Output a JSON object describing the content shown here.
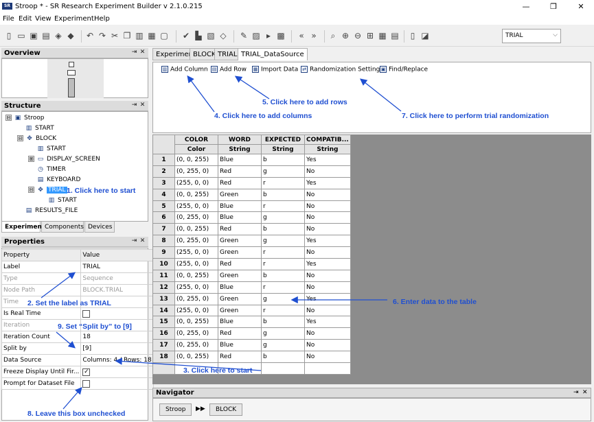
{
  "window": {
    "app_icon_text": "SR",
    "title": "Stroop * - SR Research Experiment Builder v 2.1.0.215",
    "minimize": "—",
    "maximize": "❐",
    "close": "✕"
  },
  "menu": [
    "File",
    "Edit",
    "View",
    "Experiment",
    "Help"
  ],
  "toolbar": {
    "combo_value": "TRIAL",
    "combo_arrow": "⌵",
    "icons": [
      "new-icon",
      "open-icon",
      "save-icon",
      "save-all-icon",
      "package-icon",
      "deploy-icon",
      "undo-icon",
      "redo-icon",
      "cut-icon",
      "copy-icon",
      "paste-icon",
      "delete-icon",
      "lock-icon",
      "check-icon",
      "build-icon",
      "run-icon",
      "validate-icon",
      "preferences-icon",
      "import-icon",
      "play-icon",
      "export-icon",
      "back-icon",
      "forward-icon",
      "zoom-icon",
      "zoom-in-icon",
      "zoom-out-icon",
      "fit-icon",
      "grid-icon",
      "table-icon",
      "tab-icon",
      "detach-icon"
    ]
  },
  "overview": {
    "title": "Overview"
  },
  "structure": {
    "title": "Structure",
    "tree": [
      {
        "label": "Stroop",
        "icon": "experiment-icon",
        "expander": "⊟"
      },
      {
        "label": "START",
        "icon": "start-icon"
      },
      {
        "label": "BLOCK",
        "icon": "sequence-icon",
        "expander": "⊟"
      },
      {
        "label": "START",
        "icon": "start-icon"
      },
      {
        "label": "DISPLAY_SCREEN",
        "icon": "display-screen-icon",
        "expander": "⊞"
      },
      {
        "label": "TIMER",
        "icon": "timer-icon"
      },
      {
        "label": "KEYBOARD",
        "icon": "keyboard-icon"
      },
      {
        "label": "TRIAL",
        "icon": "sequence-icon",
        "expander": "⊟"
      },
      {
        "label": "START",
        "icon": "start-icon"
      },
      {
        "label": "RESULTS_FILE",
        "icon": "results-file-icon"
      }
    ],
    "tabs": [
      "Experiment",
      "Components",
      "Devices"
    ]
  },
  "properties": {
    "title": "Properties",
    "col_property": "Property",
    "col_value": "Value",
    "rows": [
      {
        "property": "Label",
        "value": "TRIAL",
        "greyed": false
      },
      {
        "property": "Type",
        "value": "Sequence",
        "greyed": true
      },
      {
        "property": "Node Path",
        "value": "BLOCK.TRIAL",
        "greyed": true
      },
      {
        "property": "Time",
        "value": "",
        "greyed": true
      },
      {
        "property": "Is Real Time",
        "value": "",
        "checkbox": true,
        "checked": false,
        "greyed": false
      },
      {
        "property": "Iteration",
        "value": "",
        "greyed": true
      },
      {
        "property": "Iteration Count",
        "value": "18",
        "greyed": false
      },
      {
        "property": "Split by",
        "value": "[9]",
        "greyed": false
      },
      {
        "property": "Data Source",
        "value": "Columns: 4 / Rows: 18",
        "greyed": false
      },
      {
        "property": "Freeze Display Until Fir...",
        "value": "",
        "checkbox": true,
        "checked": true,
        "greyed": false
      },
      {
        "property": "Prompt for Dataset File",
        "value": "",
        "checkbox": true,
        "checked": false,
        "greyed": false
      }
    ]
  },
  "editor": {
    "tabs": [
      "Experiment",
      "BLOCK",
      "TRIAL",
      "TRIAL_DataSource"
    ],
    "active_tab": "TRIAL_DataSource",
    "ds_buttons": [
      "Add Column",
      "Add Row",
      "Import Data",
      "Randomization Setting",
      "Find/Replace"
    ]
  },
  "datasource": {
    "columns": [
      {
        "name": "COLOR",
        "type": "Color"
      },
      {
        "name": "WORD",
        "type": "String"
      },
      {
        "name": "EXPECTED",
        "type": "String"
      },
      {
        "name": "COMPATIB...",
        "type": "String"
      }
    ],
    "rows": [
      [
        "1",
        "(0, 0, 255)",
        "Blue",
        "b",
        "Yes"
      ],
      [
        "2",
        "(0, 255, 0)",
        "Red",
        "g",
        "No"
      ],
      [
        "3",
        "(255, 0, 0)",
        "Red",
        "r",
        "Yes"
      ],
      [
        "4",
        "(0, 0, 255)",
        "Green",
        "b",
        "No"
      ],
      [
        "5",
        "(255, 0, 0)",
        "Blue",
        "r",
        "No"
      ],
      [
        "6",
        "(0, 255, 0)",
        "Blue",
        "g",
        "No"
      ],
      [
        "7",
        "(0, 0, 255)",
        "Red",
        "b",
        "No"
      ],
      [
        "8",
        "(0, 255, 0)",
        "Green",
        "g",
        "Yes"
      ],
      [
        "9",
        "(255, 0, 0)",
        "Green",
        "r",
        "No"
      ],
      [
        "10",
        "(255, 0, 0)",
        "Red",
        "r",
        "Yes"
      ],
      [
        "11",
        "(0, 0, 255)",
        "Green",
        "b",
        "No"
      ],
      [
        "12",
        "(255, 0, 0)",
        "Blue",
        "r",
        "No"
      ],
      [
        "13",
        "(0, 255, 0)",
        "Green",
        "g",
        "Yes"
      ],
      [
        "14",
        "(255, 0, 0)",
        "Green",
        "r",
        "No"
      ],
      [
        "15",
        "(0, 0, 255)",
        "Blue",
        "b",
        "Yes"
      ],
      [
        "16",
        "(0, 255, 0)",
        "Red",
        "g",
        "No"
      ],
      [
        "17",
        "(0, 255, 0)",
        "Blue",
        "g",
        "No"
      ],
      [
        "18",
        "(0, 0, 255)",
        "Red",
        "b",
        "No"
      ]
    ]
  },
  "navigator": {
    "title": "Navigator",
    "crumbs": [
      "Stroop",
      "BLOCK"
    ],
    "separator": "▶▶"
  },
  "annotations": {
    "a1": "1. Click here to start",
    "a2": "2. Set the label as TRIAL",
    "a3": "3. Click here to start",
    "a4": "4. Click here to add columns",
    "a5": "5. Click here to add rows",
    "a6": "6. Enter data to the table",
    "a7": "7. Click here to perform trial randomization",
    "a8": "8. Leave this box unchecked",
    "a9": "9. Set “Split by” to [9]",
    "color": "#1f4fd1"
  }
}
